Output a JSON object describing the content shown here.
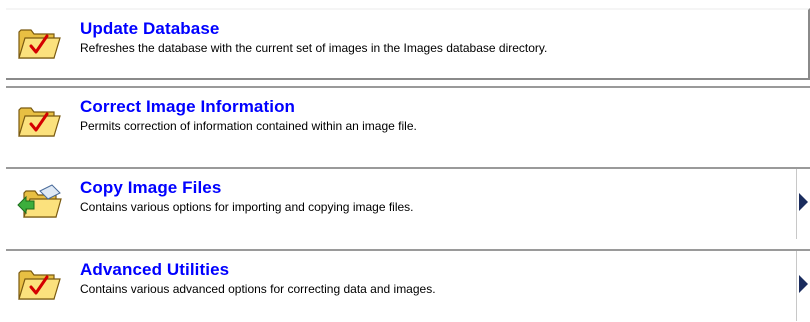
{
  "items": [
    {
      "title": "Update Database",
      "description": "Refreshes the database with the current set of images in the Images database directory.",
      "icon": "folder-check-icon",
      "has_submenu": false
    },
    {
      "title": "Correct Image Information",
      "description": "Permits correction of information contained within an image file.",
      "icon": "folder-check-icon",
      "has_submenu": false
    },
    {
      "title": "Copy Image Files",
      "description": "Contains various options for importing and copying image files.",
      "icon": "folder-copy-icon",
      "has_submenu": true
    },
    {
      "title": "Advanced Utilities",
      "description": "Contains various advanced options for correcting data and images.",
      "icon": "folder-check-icon",
      "has_submenu": true
    }
  ],
  "colors": {
    "title": "#0000ff",
    "folder": "#f3d36b",
    "check": "#d40000",
    "arrow": "#1a2c5e"
  }
}
